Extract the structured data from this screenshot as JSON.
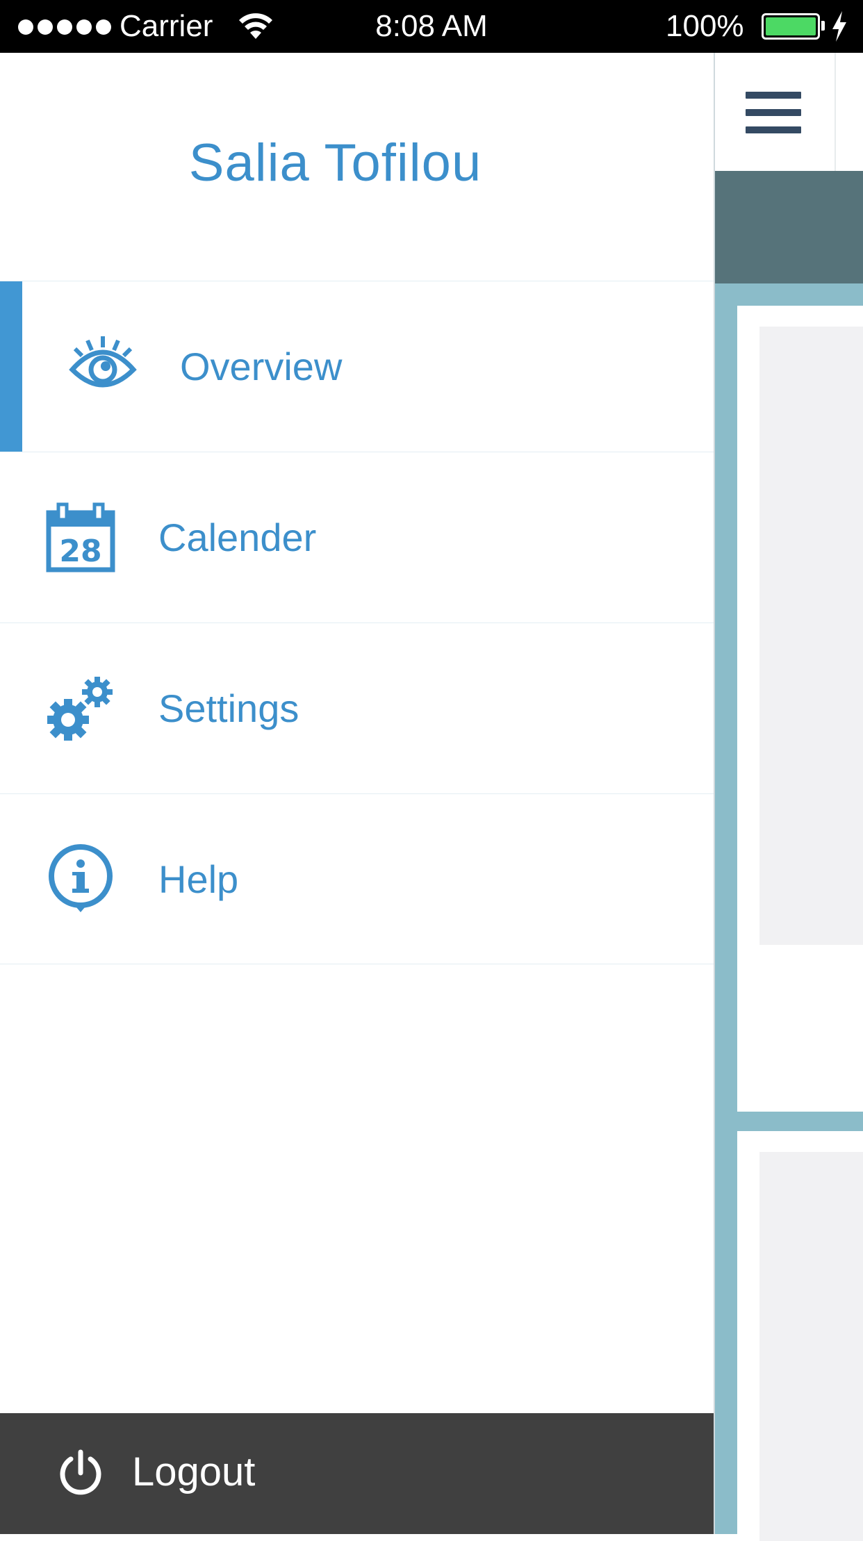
{
  "status_bar": {
    "carrier": "Carrier",
    "time": "8:08 AM",
    "battery_percent": "100%",
    "battery_level": 1.0,
    "battery_color": "#4cd964"
  },
  "drawer": {
    "profile_name": "Salia  Tofilou",
    "accent_color": "#3c8fcb",
    "menu_items": [
      {
        "label": "Overview",
        "icon": "eye-icon",
        "active": true
      },
      {
        "label": "Calender",
        "icon": "calendar-icon",
        "icon_text": "28",
        "active": false
      },
      {
        "label": "Settings",
        "icon": "gears-icon",
        "active": false
      },
      {
        "label": "Help",
        "icon": "info-icon",
        "active": false
      }
    ],
    "logout": {
      "label": "Logout",
      "icon": "power-icon",
      "background": "#404040"
    }
  },
  "background_screen": {
    "menu_icon": "hamburger-icon"
  }
}
